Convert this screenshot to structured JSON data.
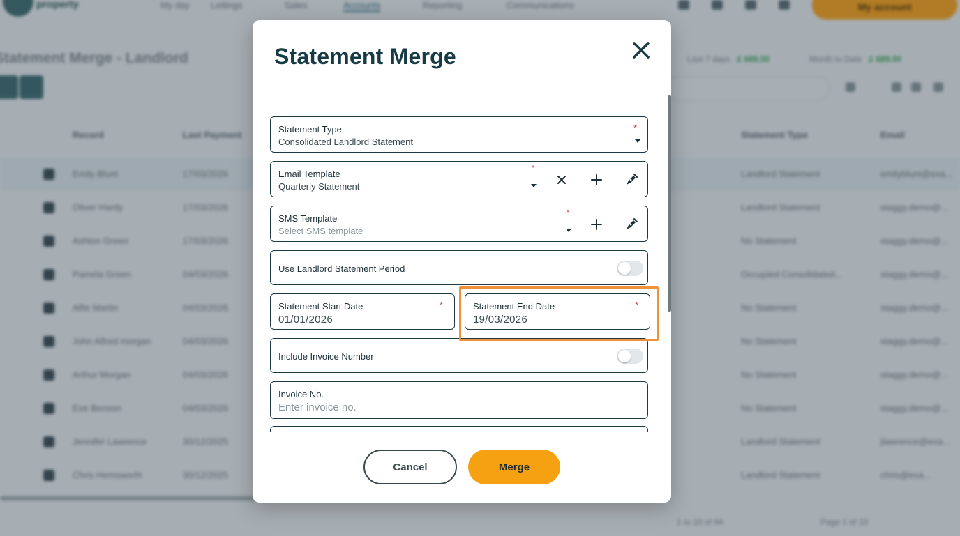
{
  "background": {
    "logo_text": "property",
    "nav": [
      "My day",
      "Lettings",
      "Sales",
      "Accounts",
      "Reporting",
      "Communications"
    ],
    "account_label": "My account",
    "page_title": "Statement Merge - Landlord",
    "stats": [
      {
        "label": "Last 7 days",
        "value": "£ 689.00"
      },
      {
        "label": "Month to Date",
        "value": "£ 689.00"
      }
    ],
    "columns": [
      "Record",
      "Last Payment",
      "Statement Type",
      "Email"
    ],
    "rows": [
      {
        "record": "Emily Blunt",
        "date": "17/03/2026",
        "type": "Landlord Statement",
        "email": "emilyblunt@exa..."
      },
      {
        "record": "Oliver Hardy",
        "date": "17/03/2026",
        "type": "Landlord Statement",
        "email": "staggy.demo@..."
      },
      {
        "record": "Ashton Green",
        "date": "17/03/2026",
        "type": "No Statement",
        "email": "staggy.demo@..."
      },
      {
        "record": "Pamela Green",
        "date": "04/03/2026",
        "type": "Occupied Consolidated...",
        "email": "staggy.demo@..."
      },
      {
        "record": "Alfie Martin",
        "date": "04/03/2026",
        "type": "No Statement",
        "email": "staggy.demo@..."
      },
      {
        "record": "John Alfred morgan",
        "date": "04/03/2026",
        "type": "No Statement",
        "email": "staggy.demo@..."
      },
      {
        "record": "Arthur Morgan",
        "date": "04/03/2026",
        "type": "No Statement",
        "email": "staggy.demo@..."
      },
      {
        "record": "Eve Benson",
        "date": "04/03/2026",
        "type": "No Statement",
        "email": "staggy.demo@..."
      },
      {
        "record": "Jennifer Lawrence",
        "date": "30/12/2025",
        "type": "Landlord Statement",
        "email": "jlawrence@exa..."
      },
      {
        "record": "Chris Hemsworth",
        "date": "30/12/2025",
        "type": "Landlord Statement",
        "email": "chris@exa..."
      }
    ],
    "pager": {
      "range": "1 to 10 of 94",
      "page": "Page 1 of 10"
    }
  },
  "modal": {
    "title": "Statement Merge",
    "fields": {
      "statement_type": {
        "label": "Statement Type",
        "value": "Consolidated Landlord Statement",
        "required": "*"
      },
      "email_template": {
        "label": "Email Template",
        "value": "Quarterly Statement",
        "required": "*"
      },
      "sms_template": {
        "label": "SMS Template",
        "placeholder": "Select SMS template",
        "required": "*"
      },
      "use_landlord_period": {
        "label": "Use Landlord Statement Period",
        "enabled": false
      },
      "start_date": {
        "label": "Statement Start Date",
        "value": "01/01/2026",
        "required": "*"
      },
      "end_date": {
        "label": "Statement End Date",
        "value": "19/03/2026",
        "required": "*"
      },
      "include_invoice_number": {
        "label": "Include Invoice Number",
        "enabled": false
      },
      "invoice_no": {
        "label": "Invoice No.",
        "placeholder": "Enter invoice no."
      }
    },
    "buttons": {
      "cancel": "Cancel",
      "merge": "Merge"
    }
  },
  "colors": {
    "accent": "#f5a111",
    "title": "#173b44",
    "border": "#1e3a44",
    "required": "#d93636",
    "highlight": "#f0913a"
  },
  "icons": [
    "close-icon",
    "clear-icon",
    "plus-icon",
    "pen-icon",
    "chevron-down-icon"
  ]
}
